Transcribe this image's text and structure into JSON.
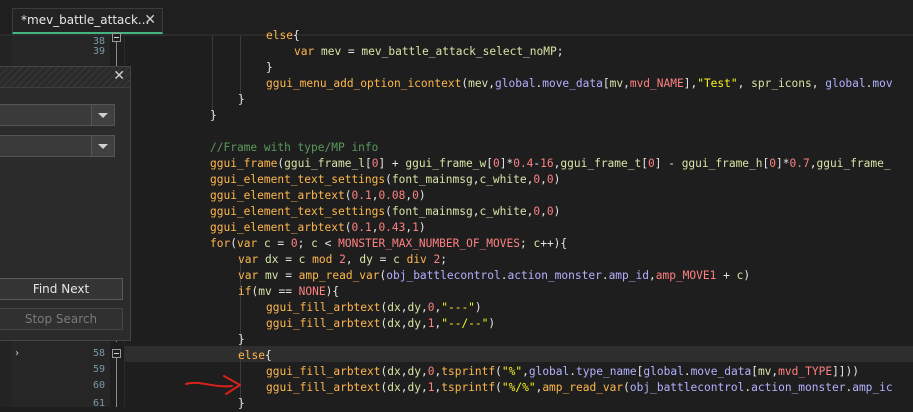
{
  "tab": {
    "title": "*mev_battle_attack...",
    "close": "✕"
  },
  "dialog": {
    "close": "✕",
    "find_next_label": "Find Next",
    "stop_search_label": "Stop Search"
  },
  "line_numbers": [
    "38",
    "39",
    "",
    "",
    "",
    "",
    "",
    "",
    "",
    "",
    "",
    "",
    "",
    "",
    "",
    "",
    "",
    "",
    "",
    "",
    "",
    "58",
    "59",
    "60",
    "61"
  ],
  "colors": {
    "tab_accent": "#43b581",
    "annotation_arrow": "#d9201a"
  }
}
